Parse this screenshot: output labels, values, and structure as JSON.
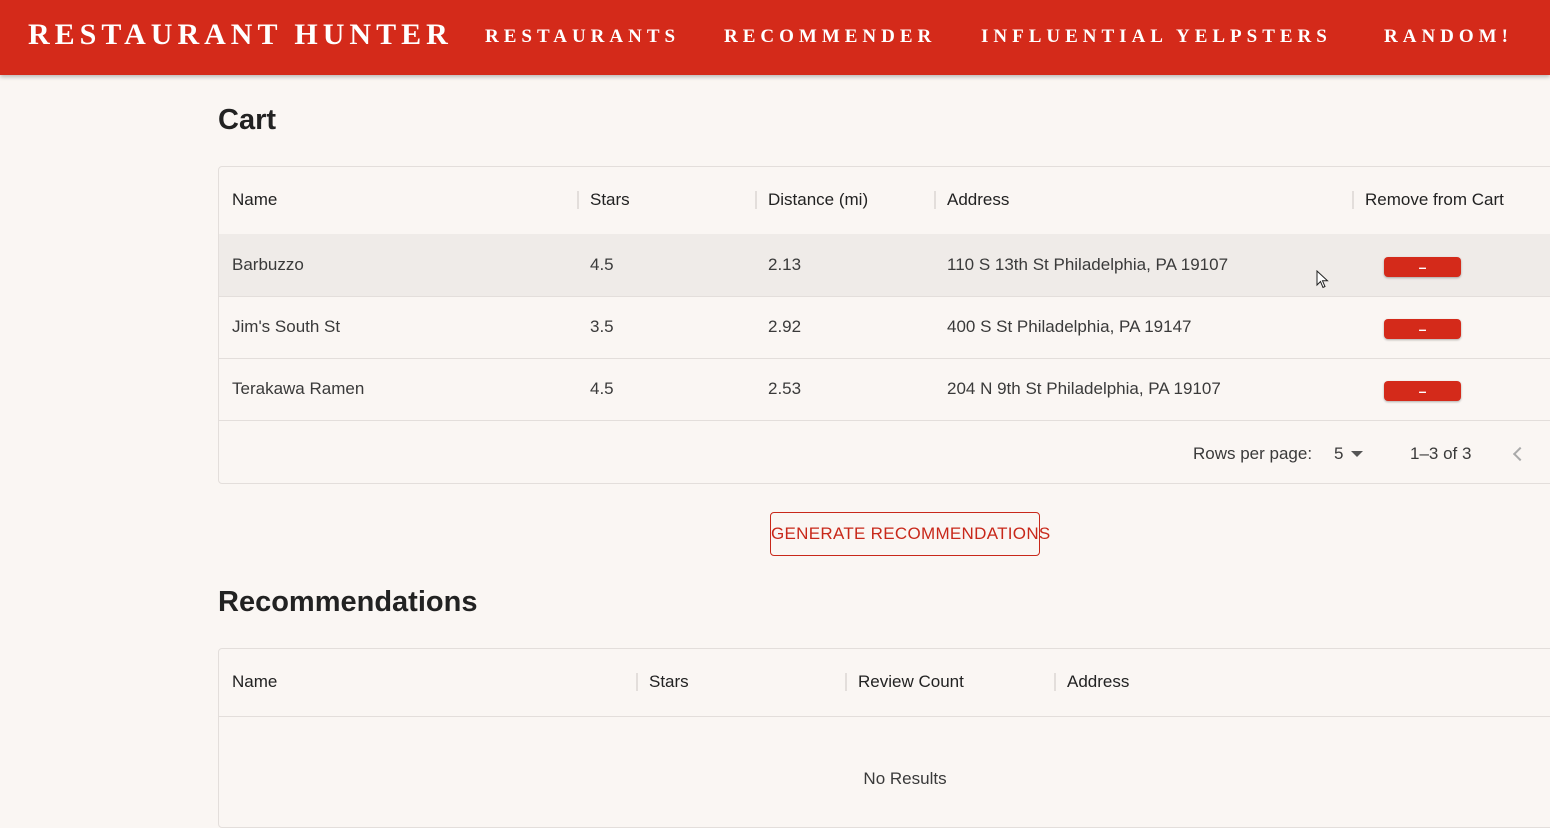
{
  "nav": {
    "brand": "RESTAURANT HUNTER",
    "links": [
      "RESTAURANTS",
      "RECOMMENDER",
      "INFLUENTIAL YELPSTERS",
      "RANDOM!"
    ]
  },
  "cart": {
    "title": "Cart",
    "columns": [
      "Name",
      "Stars",
      "Distance (mi)",
      "Address",
      "Remove from Cart"
    ],
    "rows": [
      {
        "name": "Barbuzzo",
        "stars": "4.5",
        "distance": "2.13",
        "address": "110 S 13th St Philadelphia, PA 19107",
        "remove": "–"
      },
      {
        "name": "Jim's South St",
        "stars": "3.5",
        "distance": "2.92",
        "address": "400 S St Philadelphia, PA 19147",
        "remove": "–"
      },
      {
        "name": "Terakawa Ramen",
        "stars": "4.5",
        "distance": "2.53",
        "address": "204 N 9th St Philadelphia, PA 19107",
        "remove": "–"
      }
    ],
    "pagination": {
      "rows_per_page_label": "Rows per page:",
      "rows_per_page": "5",
      "range": "1–3 of 3"
    }
  },
  "generate_button": "GENERATE RECOMMENDATIONS",
  "recommendations": {
    "title": "Recommendations",
    "columns": [
      "Name",
      "Stars",
      "Review Count",
      "Address"
    ],
    "empty": "No Results"
  },
  "colors": {
    "accent": "#d42a1a",
    "background": "#faf6f3"
  }
}
